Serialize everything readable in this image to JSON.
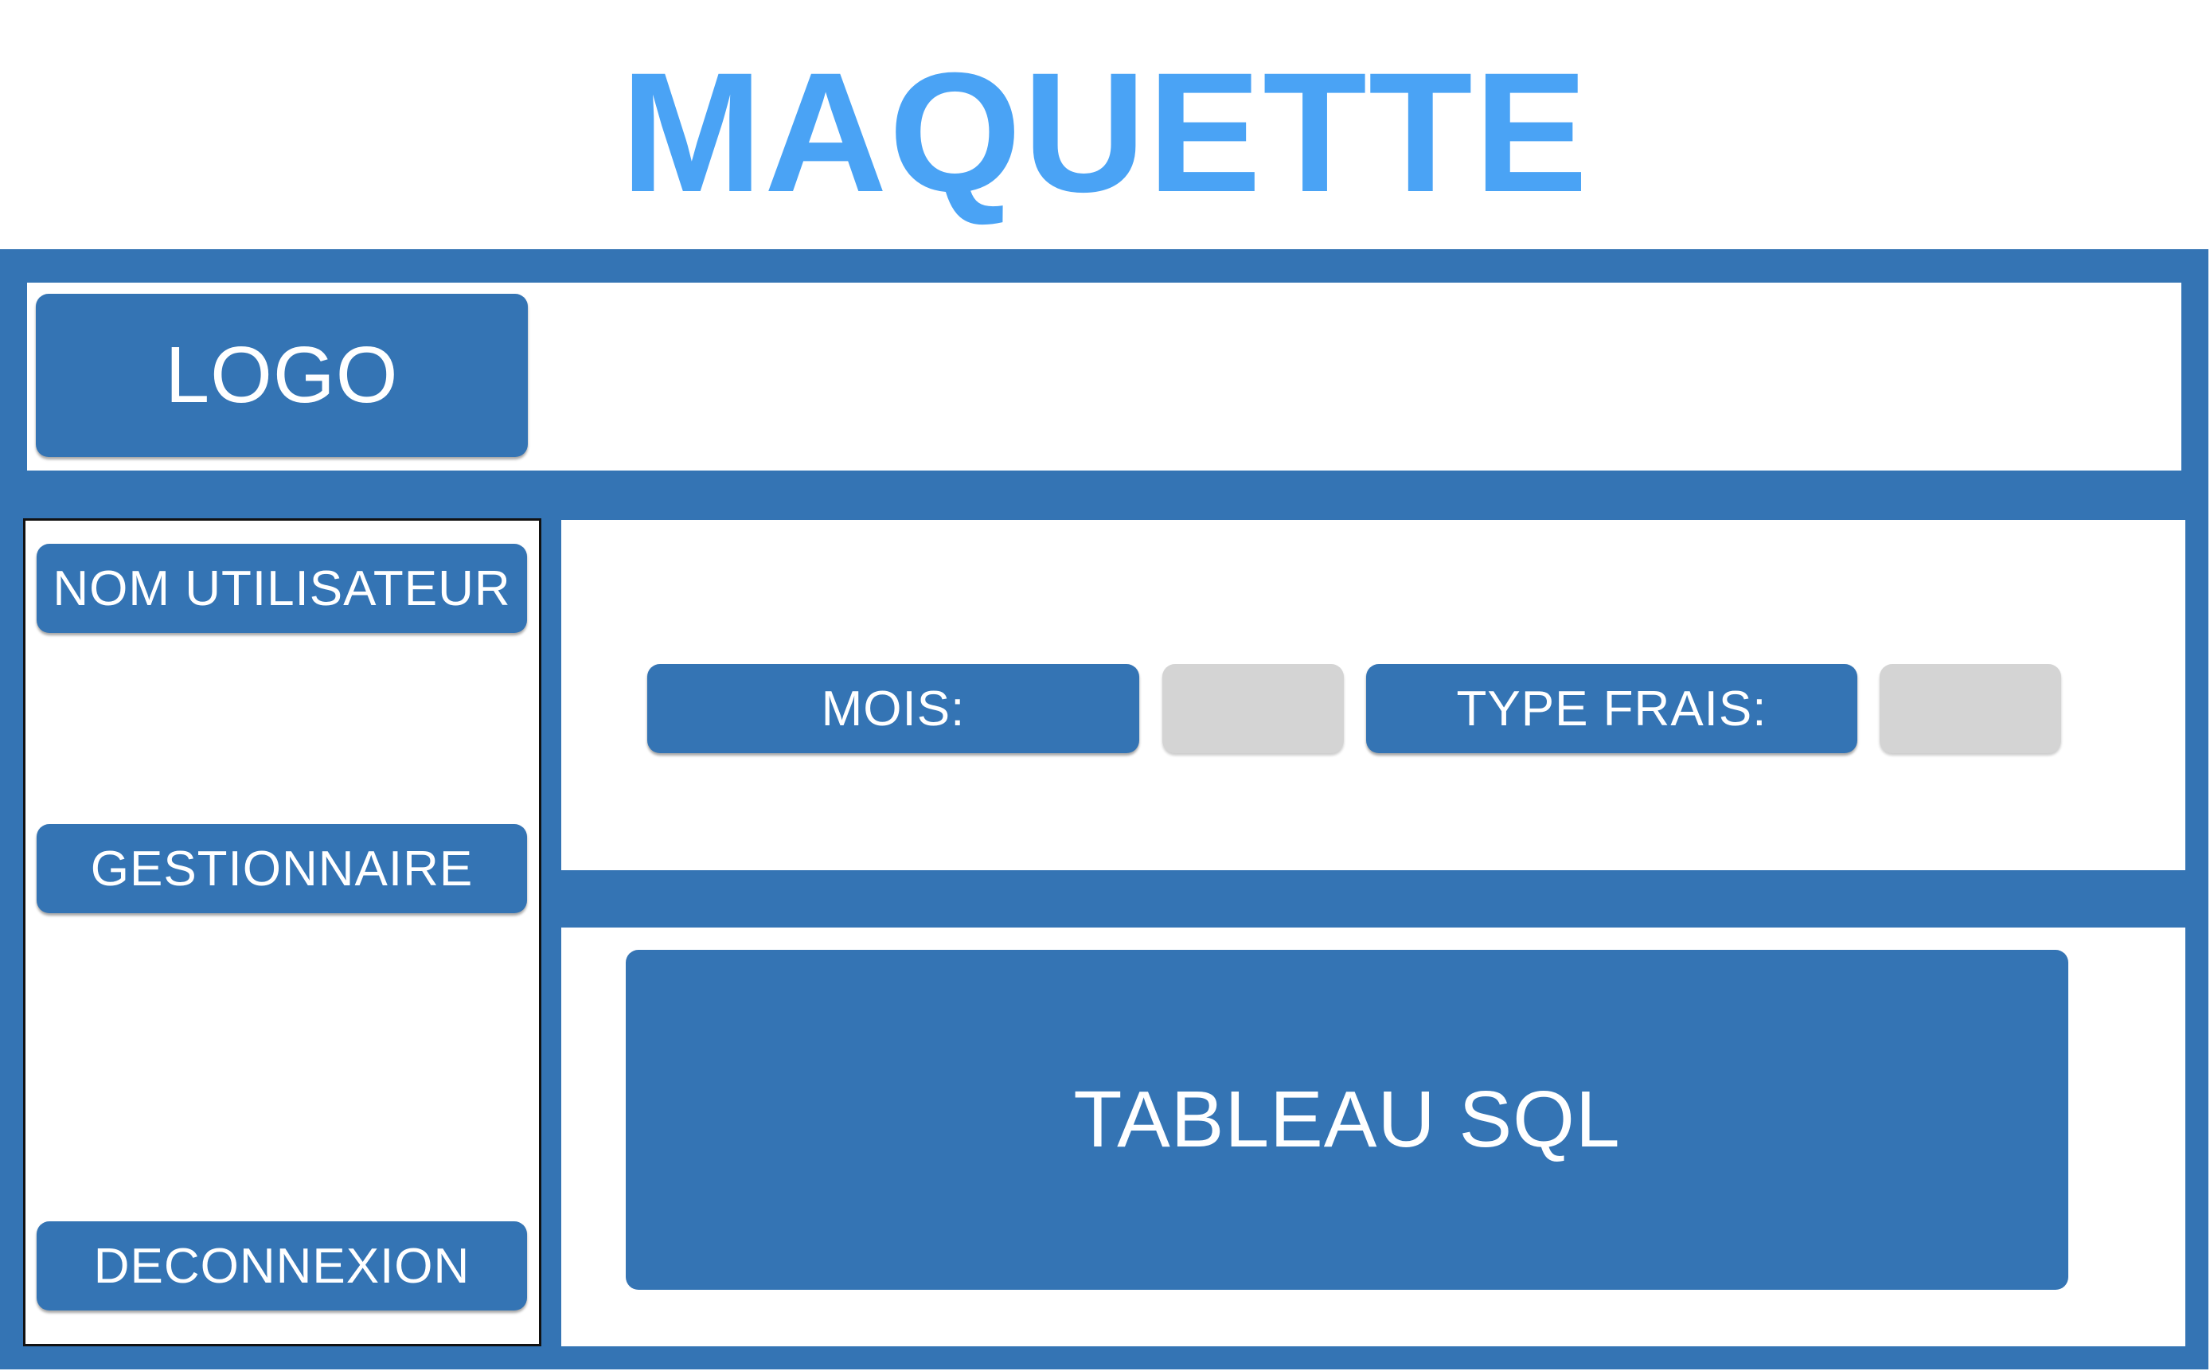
{
  "title": "MAQUETTE",
  "header": {
    "logo_label": "LOGO"
  },
  "sidebar": {
    "user_label": "NOM UTILISATEUR",
    "manager_label": "GESTIONNAIRE",
    "logout_label": "DECONNEXION"
  },
  "filters": {
    "month_label": "MOIS:",
    "expense_type_label": "TYPE FRAIS:"
  },
  "main": {
    "table_label": "TABLEAU SQL"
  },
  "colors": {
    "title": "#4aa3f5",
    "frame": "#3474b4",
    "button": "#3474b4",
    "placeholder": "#d4d4d4"
  }
}
